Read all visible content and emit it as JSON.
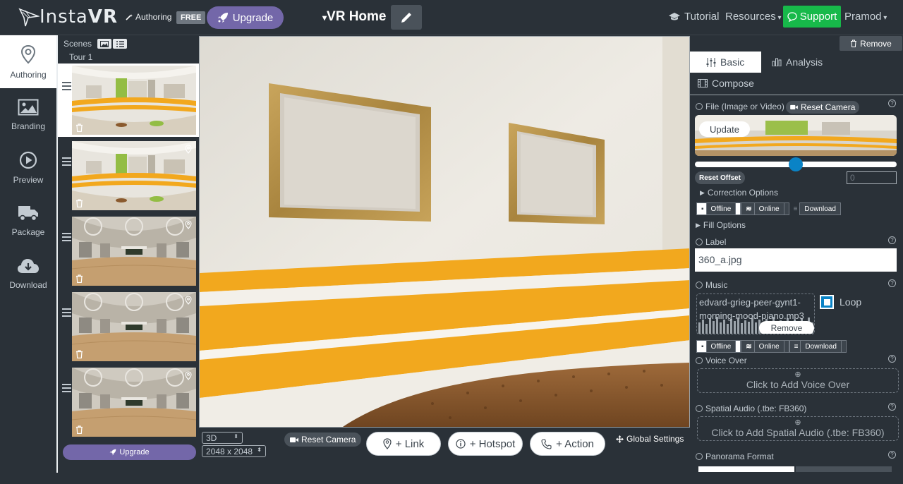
{
  "topbar": {
    "logo_thin": "Insta",
    "logo_bold": "VR",
    "mode_label": "Authoring",
    "plan_badge": "FREE",
    "upgrade_label": "Upgrade",
    "project_title": "VR Home",
    "tutorial_label": "Tutorial",
    "resources_label": "Resources",
    "support_label": "Support",
    "user_name": "Pramod"
  },
  "leftnav": {
    "items": [
      {
        "label": "Authoring",
        "icon": "map-pin-icon",
        "active": true
      },
      {
        "label": "Branding",
        "icon": "image-icon",
        "active": false
      },
      {
        "label": "Preview",
        "icon": "play-icon",
        "active": false
      },
      {
        "label": "Package",
        "icon": "truck-icon",
        "active": false
      },
      {
        "label": "Download",
        "icon": "cloud-download-icon",
        "active": false
      }
    ]
  },
  "scenes": {
    "header": "Scenes",
    "tour_label": "Tour 1",
    "upgrade_label": "Upgrade",
    "items": [
      {
        "kind": "kitchen",
        "active": true
      },
      {
        "kind": "kitchen",
        "active": false
      },
      {
        "kind": "hall",
        "active": false
      },
      {
        "kind": "hall",
        "active": false
      },
      {
        "kind": "hall",
        "active": false
      }
    ]
  },
  "bottombar": {
    "mode_value": "3D",
    "resolution_value": "2048 x 2048",
    "reset_camera_label": "Reset Camera",
    "link_label": "+ Link",
    "hotspot_label": "+ Hotspot",
    "action_label": "+ Action",
    "global_settings_label": "Global Settings"
  },
  "rightpanel": {
    "remove_label": "Remove",
    "tabs": {
      "basic": "Basic",
      "analysis": "Analysis",
      "compose": "Compose"
    },
    "file_label": "File (Image or Video)",
    "reset_camera_label": "Reset Camera",
    "update_label": "Update",
    "offset_value": 0.5,
    "reset_offset_label": "Reset Offset",
    "offset_input": "0",
    "correction_label": "Correction Options",
    "seg1": {
      "offline": "Offline",
      "online": "Online",
      "download": "Download"
    },
    "fill_label": "Fill Options",
    "label_label": "Label",
    "label_value": "360_a.jpg",
    "music_label": "Music",
    "music_file_line1": "edvard-grieg-peer-gynt1-",
    "music_file_line2": "morning-mood-piano.mp3",
    "loop_label": "Loop",
    "music_remove_label": "Remove",
    "seg2": {
      "offline": "Offline",
      "online": "Online",
      "download": "Download"
    },
    "voice_label": "Voice Over",
    "voice_add": "Click to Add Voice Over",
    "spatial_label": "Spatial Audio (.tbe: FB360)",
    "spatial_add": "Click to Add Spatial Audio (.tbe: FB360)",
    "panorama_label": "Panorama Format"
  },
  "colors": {
    "bg": "#2a3138",
    "accent_purple": "#7367a9",
    "support_green": "#17b94a",
    "slider_blue": "#0a83c6",
    "wall_orange": "#f2a81e"
  }
}
